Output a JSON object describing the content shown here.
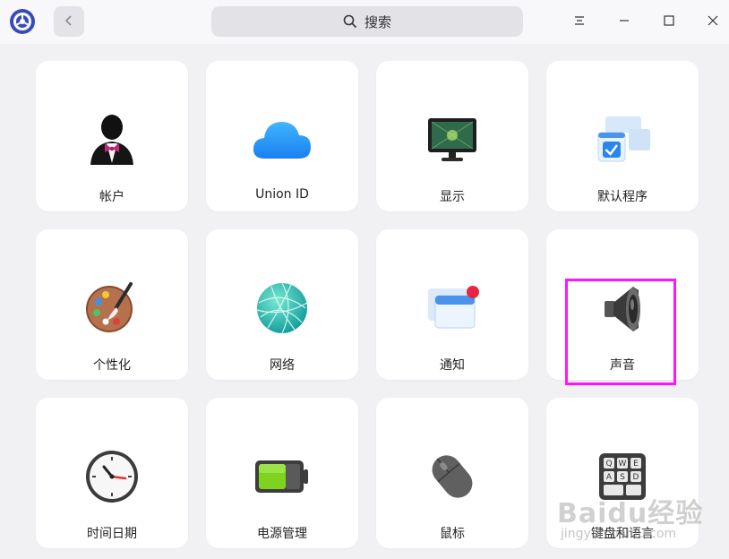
{
  "titlebar": {
    "search_label": "搜索"
  },
  "modules": [
    {
      "label": "帐户",
      "icon": "account-icon"
    },
    {
      "label": "Union ID",
      "icon": "cloud-icon"
    },
    {
      "label": "显示",
      "icon": "display-icon"
    },
    {
      "label": "默认程序",
      "icon": "default-apps-icon"
    },
    {
      "label": "个性化",
      "icon": "palette-icon"
    },
    {
      "label": "网络",
      "icon": "network-globe-icon"
    },
    {
      "label": "通知",
      "icon": "notification-icon"
    },
    {
      "label": "声音",
      "icon": "speaker-icon"
    },
    {
      "label": "时间日期",
      "icon": "clock-icon"
    },
    {
      "label": "电源管理",
      "icon": "battery-icon"
    },
    {
      "label": "鼠标",
      "icon": "mouse-icon"
    },
    {
      "label": "键盘和语言",
      "icon": "keyboard-icon"
    }
  ],
  "colors": {
    "highlight": "#ff14ff",
    "background": "#f1f1f4",
    "card": "#ffffff"
  },
  "watermark": {
    "text": "Baidu经验",
    "sub": "jingyan.baidu.com"
  }
}
